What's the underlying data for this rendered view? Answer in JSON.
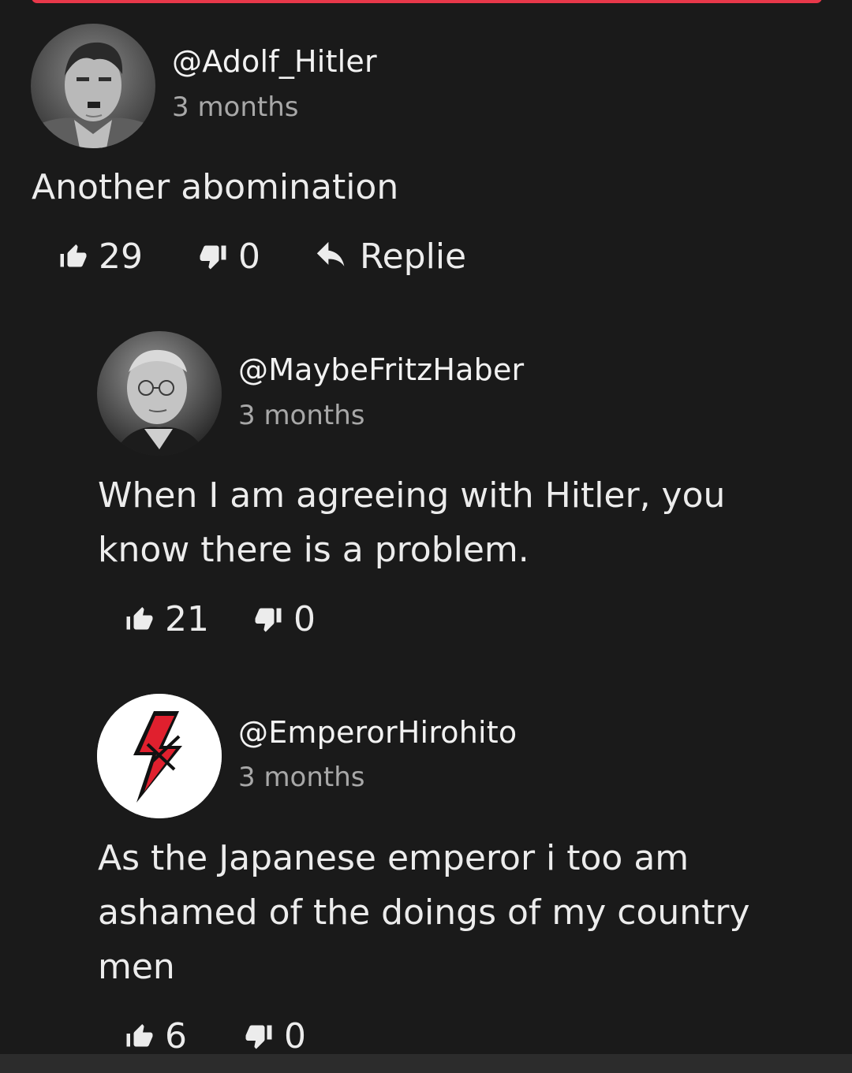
{
  "colors": {
    "background": "#1a1a1a",
    "accent": "#e8384a",
    "text": "#ececec",
    "muted": "#a8a8a8"
  },
  "comments": [
    {
      "username": "@Adolf_Hitler",
      "timestamp": "3 months",
      "text": "Another abomination",
      "likes": "29",
      "dislikes": "0",
      "reply_label": "Replie",
      "avatar_icon": "profile-photo-icon"
    },
    {
      "username": "@MaybeFritzHaber",
      "timestamp": "3 months",
      "text": "When I am agreeing with Hitler, you\nknow there is a problem.",
      "likes": "21",
      "dislikes": "0",
      "avatar_icon": "profile-photo-icon"
    },
    {
      "username": "@EmperorHirohito",
      "timestamp": "3 months",
      "text": "As the Japanese emperor i too am\nashamed of the doings of my country\nmen",
      "likes": "6",
      "dislikes": "0",
      "avatar_icon": "red-lightning-logo-icon"
    }
  ]
}
